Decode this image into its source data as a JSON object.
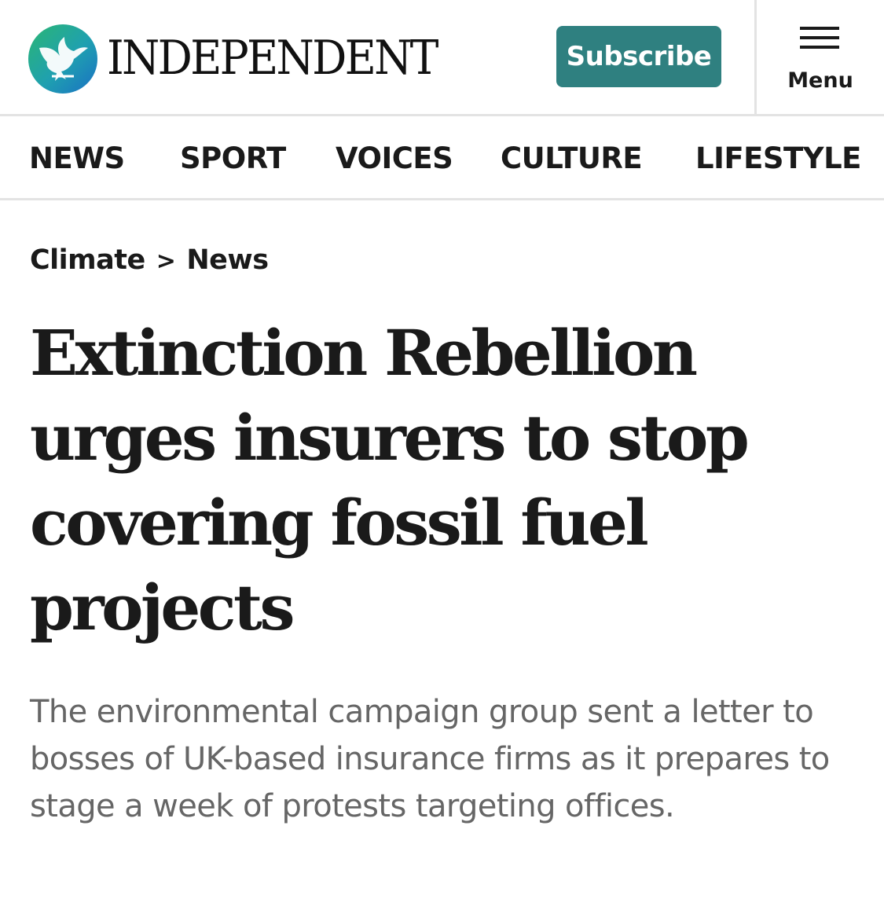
{
  "masthead": {
    "brand_name": "INDEPENDENT",
    "logo_icon": "eagle-logo-icon",
    "subscribe_label": "Subscribe",
    "menu_label": "Menu",
    "menu_icon": "hamburger-icon"
  },
  "nav": {
    "items": [
      {
        "label": "NEWS"
      },
      {
        "label": "SPORT"
      },
      {
        "label": "VOICES"
      },
      {
        "label": "CULTURE"
      },
      {
        "label": "LIFESTYLE"
      }
    ]
  },
  "article": {
    "breadcrumb": {
      "section": "Climate",
      "separator": ">",
      "subsection": "News"
    },
    "headline": "Extinction Rebellion urges insurers to stop covering fossil fuel projects",
    "standfirst": "The environmental campaign group sent a letter to bosses of UK-based insurance firms as it prepares to stage a week of protests targeting offices."
  },
  "colors": {
    "accent": "#2f8080",
    "text": "#1a1a1a",
    "standfirst_text": "#666666",
    "divider": "#e3e3e3"
  }
}
